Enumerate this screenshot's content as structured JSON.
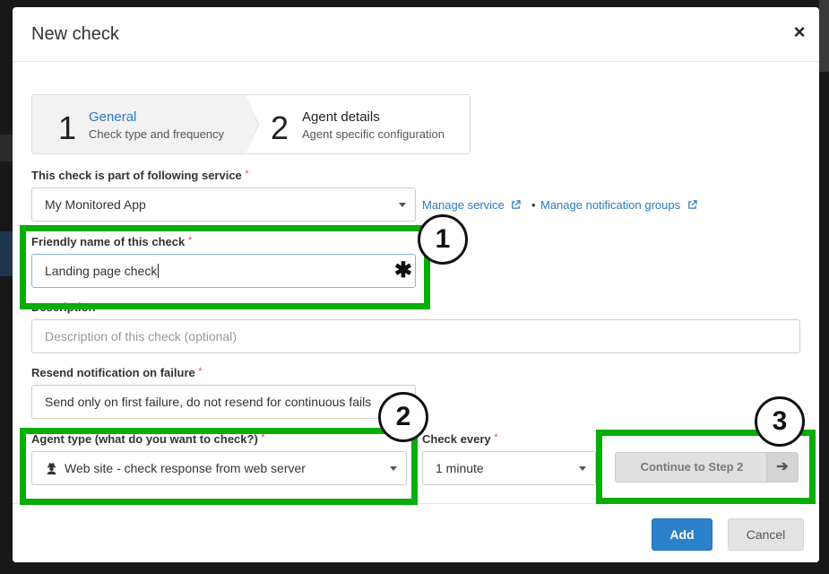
{
  "modal": {
    "title": "New check",
    "close_glyph": "×"
  },
  "steps": [
    {
      "number": "1",
      "title": "General",
      "subtitle": "Check type and frequency"
    },
    {
      "number": "2",
      "title": "Agent details",
      "subtitle": "Agent specific configuration"
    }
  ],
  "service": {
    "label": "This check is part of following service",
    "required_mark": "*",
    "value": "My Monitored App",
    "manage_service_link": "Manage service",
    "separator": "•",
    "manage_groups_link": "Manage notification groups"
  },
  "friendly_name": {
    "label": "Friendly name of this check",
    "required_mark": "*",
    "value": "Landing page check",
    "icon_glyph": "✱"
  },
  "description": {
    "label": "Description",
    "placeholder": "Description of this check (optional)"
  },
  "resend": {
    "label": "Resend notification on failure",
    "required_mark": "*",
    "value": "Send only on first failure, do not resend for continuous fails"
  },
  "agent_type": {
    "label": "Agent type (what do you want to check?)",
    "required_mark": "*",
    "value": "Web site - check response from web server",
    "icon": "user-secret-icon"
  },
  "check_every": {
    "label": "Check every",
    "required_mark": "*",
    "value": "1 minute"
  },
  "continue_button": {
    "label": "Continue to Step 2",
    "arrow_glyph": "➔"
  },
  "footer": {
    "add_label": "Add",
    "cancel_label": "Cancel"
  },
  "annotations": [
    "1",
    "2",
    "3"
  ],
  "colors": {
    "accent": "#2a7ac0",
    "primary_button": "#2b82cb",
    "highlight": "#08ad08",
    "required": "#d9534f"
  }
}
